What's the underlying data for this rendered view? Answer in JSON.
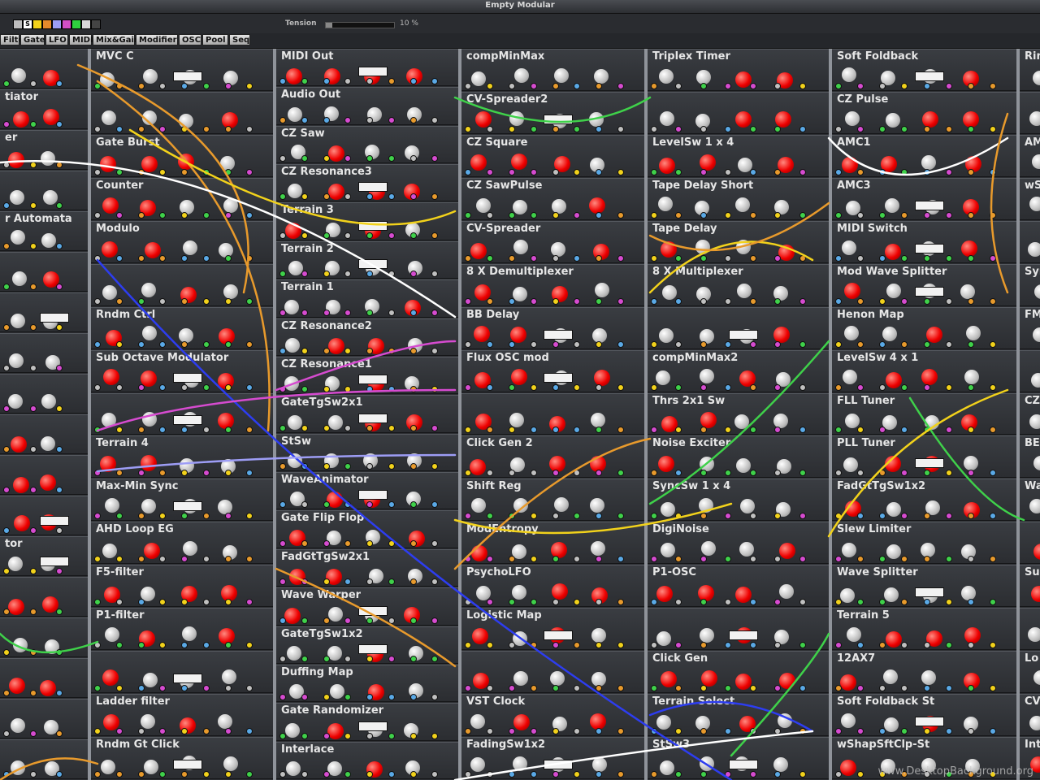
{
  "window": {
    "title": "Empty Modular"
  },
  "toolbar": {
    "swatch_colors": [
      "#bdbdbd",
      "#ffffff",
      "#f2d21b",
      "#e58a2b",
      "#9d9df5",
      "#d34ec6",
      "#2fd13f",
      "#d7d7d7",
      "#444444"
    ],
    "swatch_letter": "S",
    "tension_label": "Tension",
    "tension_value": "10 %",
    "tension_fraction": 0.1
  },
  "menu": [
    "Filter",
    "Gate",
    "LFO",
    "MIDI",
    "Mix&Gain",
    "Modifier",
    "OSC",
    "Pool",
    "Seq"
  ],
  "wire_colors": [
    "#e89a2c",
    "#f2d21b",
    "#2d3df0",
    "#ffffff",
    "#3fd14a",
    "#d64bd0",
    "#9d9df5",
    "#ff8a80"
  ],
  "columns": [
    {
      "modules": [
        "",
        "tiator",
        "er",
        "",
        "r Automata",
        "",
        "",
        "",
        "",
        "",
        "",
        "",
        "tor",
        "",
        "",
        "",
        "",
        ""
      ]
    },
    {
      "modules": [
        "MVC C",
        "",
        "Gate  Burst",
        "Counter",
        "Modulo",
        "",
        "Rndm Ctrl",
        "Sub Octave Modulator",
        "",
        "Terrain 4",
        "Max-Min Sync",
        "AHD Loop EG",
        "F5-filter",
        "P1-filter",
        "",
        "Ladder filter",
        "Rndm Gt Click"
      ]
    },
    {
      "modules": [
        "MIDI Out",
        "Audio Out",
        "CZ Saw",
        "CZ Resonance3",
        "Terrain 3",
        "Terrain 2",
        "Terrain 1",
        "CZ Resonance2",
        "CZ Resonance1",
        "GateTgSw2x1",
        "StSw",
        "WaveAnimator",
        "Gate Flip Flop",
        "FadGtTgSw2x1",
        "Wave Warper",
        "GateTgSw1x2",
        "Duffing Map",
        "Gate Randomizer",
        "Interlace"
      ]
    },
    {
      "modules": [
        "compMinMax",
        "CV-Spreader2",
        "CZ Square",
        "CZ SawPulse",
        "CV-Spreader",
        "8 X Demultiplexer",
        "BB Delay",
        "Flux OSC mod",
        "",
        "Click Gen 2",
        "Shift Reg",
        "ModEntropy",
        "PsychoLFO",
        "Logistic Map",
        "",
        "VST Clock",
        "FadingSw1x2"
      ]
    },
    {
      "modules": [
        "Triplex Timer",
        "",
        "LevelSw 1 x 4",
        "Tape Delay Short",
        "Tape Delay",
        "8 X Multiplexer",
        "",
        "compMinMax2",
        "Thrs 2x1 Sw",
        "Noise Exciter",
        "SyncSw 1 x 4",
        "DigiNoise",
        "P1-OSC",
        "",
        "Click Gen",
        "Terrain Select",
        "StSw3"
      ]
    },
    {
      "modules": [
        "Soft Foldback",
        "CZ Pulse",
        "AMC1",
        "AMC3",
        "MIDI Switch",
        "Mod Wave Splitter",
        "Henon Map",
        "LevelSw 4 x 1",
        "FLL Tuner",
        "PLL Tuner",
        "FadGtTgSw1x2",
        "Slew Limiter",
        "Wave Splitter",
        "Terrain 5",
        "12AX7",
        "Soft Foldback St",
        "wShapSftClp-St"
      ]
    },
    {
      "modules": [
        "Ring",
        "",
        "AM",
        "wS",
        "",
        "Sym",
        "FM",
        "",
        "CZ",
        "BE",
        "Wa",
        "",
        "Sul",
        "",
        "Lo",
        "CV",
        "Inte"
      ]
    }
  ],
  "watermark": "www.DesktopBackground.org"
}
